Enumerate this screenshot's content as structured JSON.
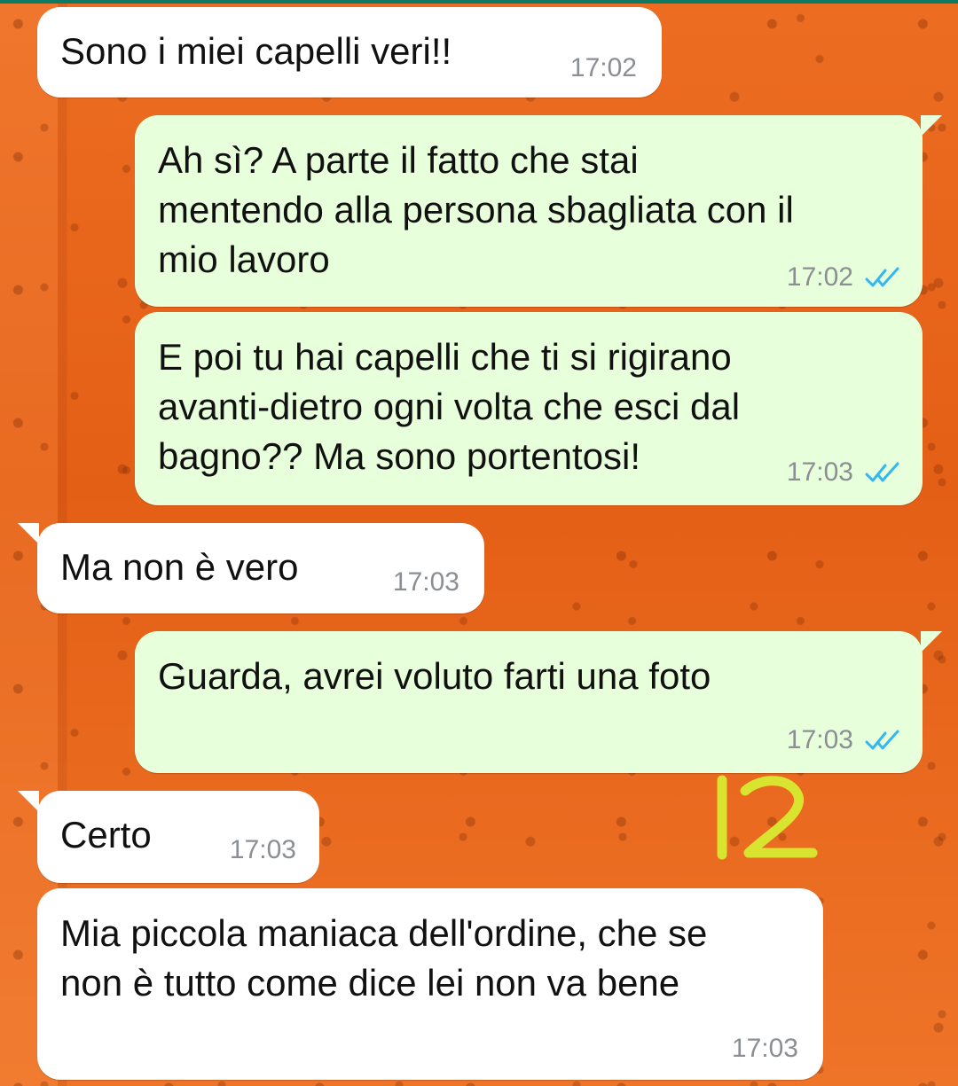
{
  "theme": {
    "incoming_bubble": "#ffffff",
    "outgoing_bubble": "#e7ffdb",
    "read_tick_color": "#34b7f1",
    "timestamp_color": "#8b8f93",
    "annotation_color": "#d8e42f",
    "wallpaper": "#e8661c"
  },
  "messages": [
    {
      "direction": "incoming",
      "text": "Sono i miei capelli veri!!",
      "time": "17:02"
    },
    {
      "direction": "outgoing",
      "text": "Ah sì? A parte il fatto che stai\nmentendo alla persona sbagliata con il\nmio lavoro",
      "time": "17:02",
      "status_icon": "double-check-icon"
    },
    {
      "direction": "outgoing",
      "text": "E poi tu hai capelli che ti si rigirano\navanti-dietro ogni volta che esci dal\nbagno?? Ma sono portentosi!",
      "time": "17:03",
      "status_icon": "double-check-icon"
    },
    {
      "direction": "incoming",
      "text": "Ma non è vero",
      "time": "17:03"
    },
    {
      "direction": "outgoing",
      "text": "Guarda, avrei voluto farti una foto",
      "time": "17:03",
      "status_icon": "double-check-icon"
    },
    {
      "direction": "incoming",
      "text": "Certo",
      "time": "17:03"
    },
    {
      "direction": "incoming",
      "text": "Mia piccola maniaca dell'ordine, che se\nnon è tutto come dice lei non va bene",
      "time": "17:03"
    }
  ],
  "annotation": {
    "text": "12",
    "style": "handwritten"
  }
}
